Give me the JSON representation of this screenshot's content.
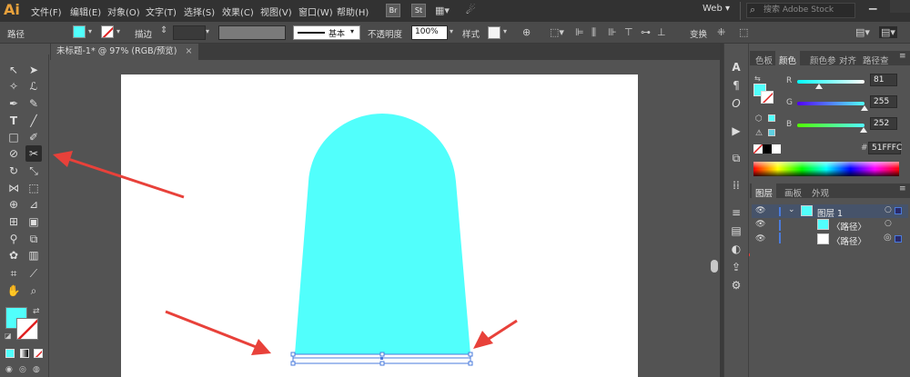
{
  "app": {
    "logo": "Ai",
    "menus": [
      "文件(F)",
      "编辑(E)",
      "对象(O)",
      "文字(T)",
      "选择(S)",
      "效果(C)",
      "视图(V)",
      "窗口(W)",
      "帮助(H)"
    ],
    "bridge_btn": "Br",
    "stock_btn": "St",
    "workspace": "Web",
    "search_placeholder": "搜索 Adobe Stock"
  },
  "control_bar": {
    "selection_label": "路径",
    "stroke_label": "描边",
    "stroke_style": "基本",
    "opacity_label": "不透明度",
    "opacity_value": "100%",
    "style_label": "样式",
    "transform_label": "变换"
  },
  "document": {
    "tab_title": "未标题-1* @ 97% (RGB/预览)"
  },
  "colors": {
    "fill": "#51FFFC",
    "menubar": "#323232",
    "ui": "#535353",
    "annotation_arrow": "#e8413a",
    "selection": "#4a7bdc"
  },
  "color_panel": {
    "tabs": [
      "色板",
      "颜色",
      "颜色参",
      "对齐",
      "路径查"
    ],
    "active_tab": "颜色",
    "channels": [
      {
        "name": "R",
        "value": "81",
        "fraction": 0.32
      },
      {
        "name": "G",
        "value": "255",
        "fraction": 1.0
      },
      {
        "name": "B",
        "value": "252",
        "fraction": 0.99
      }
    ],
    "hex_label": "#",
    "hex_value": "51FFFC"
  },
  "layers_panel": {
    "tabs": [
      "图层",
      "画板",
      "外观"
    ],
    "active_tab": "图层",
    "rows": [
      {
        "label": "图层 1",
        "type": "layer"
      },
      {
        "label": "〈路径〉",
        "type": "path",
        "swatch": "#51FFFC"
      },
      {
        "label": "〈路径〉",
        "type": "path",
        "swatch": "#ffffff"
      }
    ]
  },
  "icons": {
    "toolbox": [
      "selection-tool-icon",
      "direct-selection-tool-icon",
      "magic-wand-icon",
      "lasso-icon",
      "pen-icon",
      "curvature-icon",
      "type-icon",
      "line-icon",
      "rectangle-icon",
      "paintbrush-icon",
      "shaper-icon",
      "scissors-icon",
      "rotate-icon",
      "scale-icon",
      "width-icon",
      "free-transform-icon",
      "shape-builder-icon",
      "perspective-icon",
      "mesh-icon",
      "gradient-icon",
      "eyedropper-icon",
      "blend-icon",
      "symbol-sprayer-icon",
      "graph-icon",
      "artboard-icon",
      "slice-icon",
      "hand-icon",
      "zoom-icon"
    ]
  }
}
